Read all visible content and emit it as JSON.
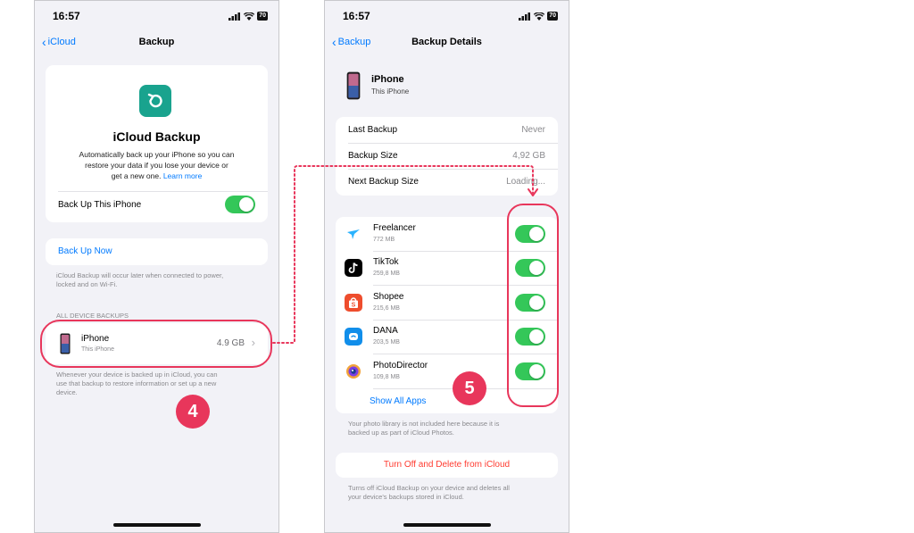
{
  "status": {
    "time": "16:57",
    "battery": "70"
  },
  "left": {
    "back_label": "iCloud",
    "title": "Backup",
    "hero_title": "iCloud Backup",
    "hero_desc_1": "Automatically back up your iPhone so you can",
    "hero_desc_2": "restore your data if you lose your device or",
    "hero_desc_3": "get a new one.",
    "learn_more": "Learn more",
    "backup_toggle_label": "Back Up This iPhone",
    "backup_now": "Back Up Now",
    "backup_note_1": "iCloud Backup will occur later when connected to power,",
    "backup_note_2": "locked and on Wi-Fi.",
    "section_header": "ALL DEVICE BACKUPS",
    "device_name": "iPhone",
    "device_sub": "This iPhone",
    "device_size": "4.9 GB",
    "device_note_1": "Whenever your device is backed up in iCloud, you can",
    "device_note_2": "use that backup to restore information or set up a new",
    "device_note_3": "device."
  },
  "right": {
    "back_label": "Backup",
    "title": "Backup Details",
    "device_name": "iPhone",
    "device_sub": "This iPhone",
    "info": [
      {
        "label": "Last Backup",
        "value": "Never"
      },
      {
        "label": "Backup Size",
        "value": "4,92 GB"
      },
      {
        "label": "Next Backup Size",
        "value": "Loading..."
      }
    ],
    "apps": [
      {
        "name": "Freelancer",
        "size": "772 MB"
      },
      {
        "name": "TikTok",
        "size": "259,8 MB"
      },
      {
        "name": "Shopee",
        "size": "215,6 MB"
      },
      {
        "name": "DANA",
        "size": "203,5 MB"
      },
      {
        "name": "PhotoDirector",
        "size": "109,8 MB"
      }
    ],
    "show_all": "Show All Apps",
    "photo_note_1": "Your photo library is not included here because it is",
    "photo_note_2": "backed up as part of iCloud Photos.",
    "turn_off": "Turn Off and Delete from iCloud",
    "turn_off_note_1": "Turns off iCloud Backup on your device and deletes all",
    "turn_off_note_2": "your device's backups stored in iCloud."
  },
  "annotations": {
    "step4": "4",
    "step5": "5"
  },
  "colors": {
    "accent": "#007aff",
    "toggle_on": "#34c759",
    "highlight": "#e8365b",
    "destructive": "#ff3b30"
  }
}
